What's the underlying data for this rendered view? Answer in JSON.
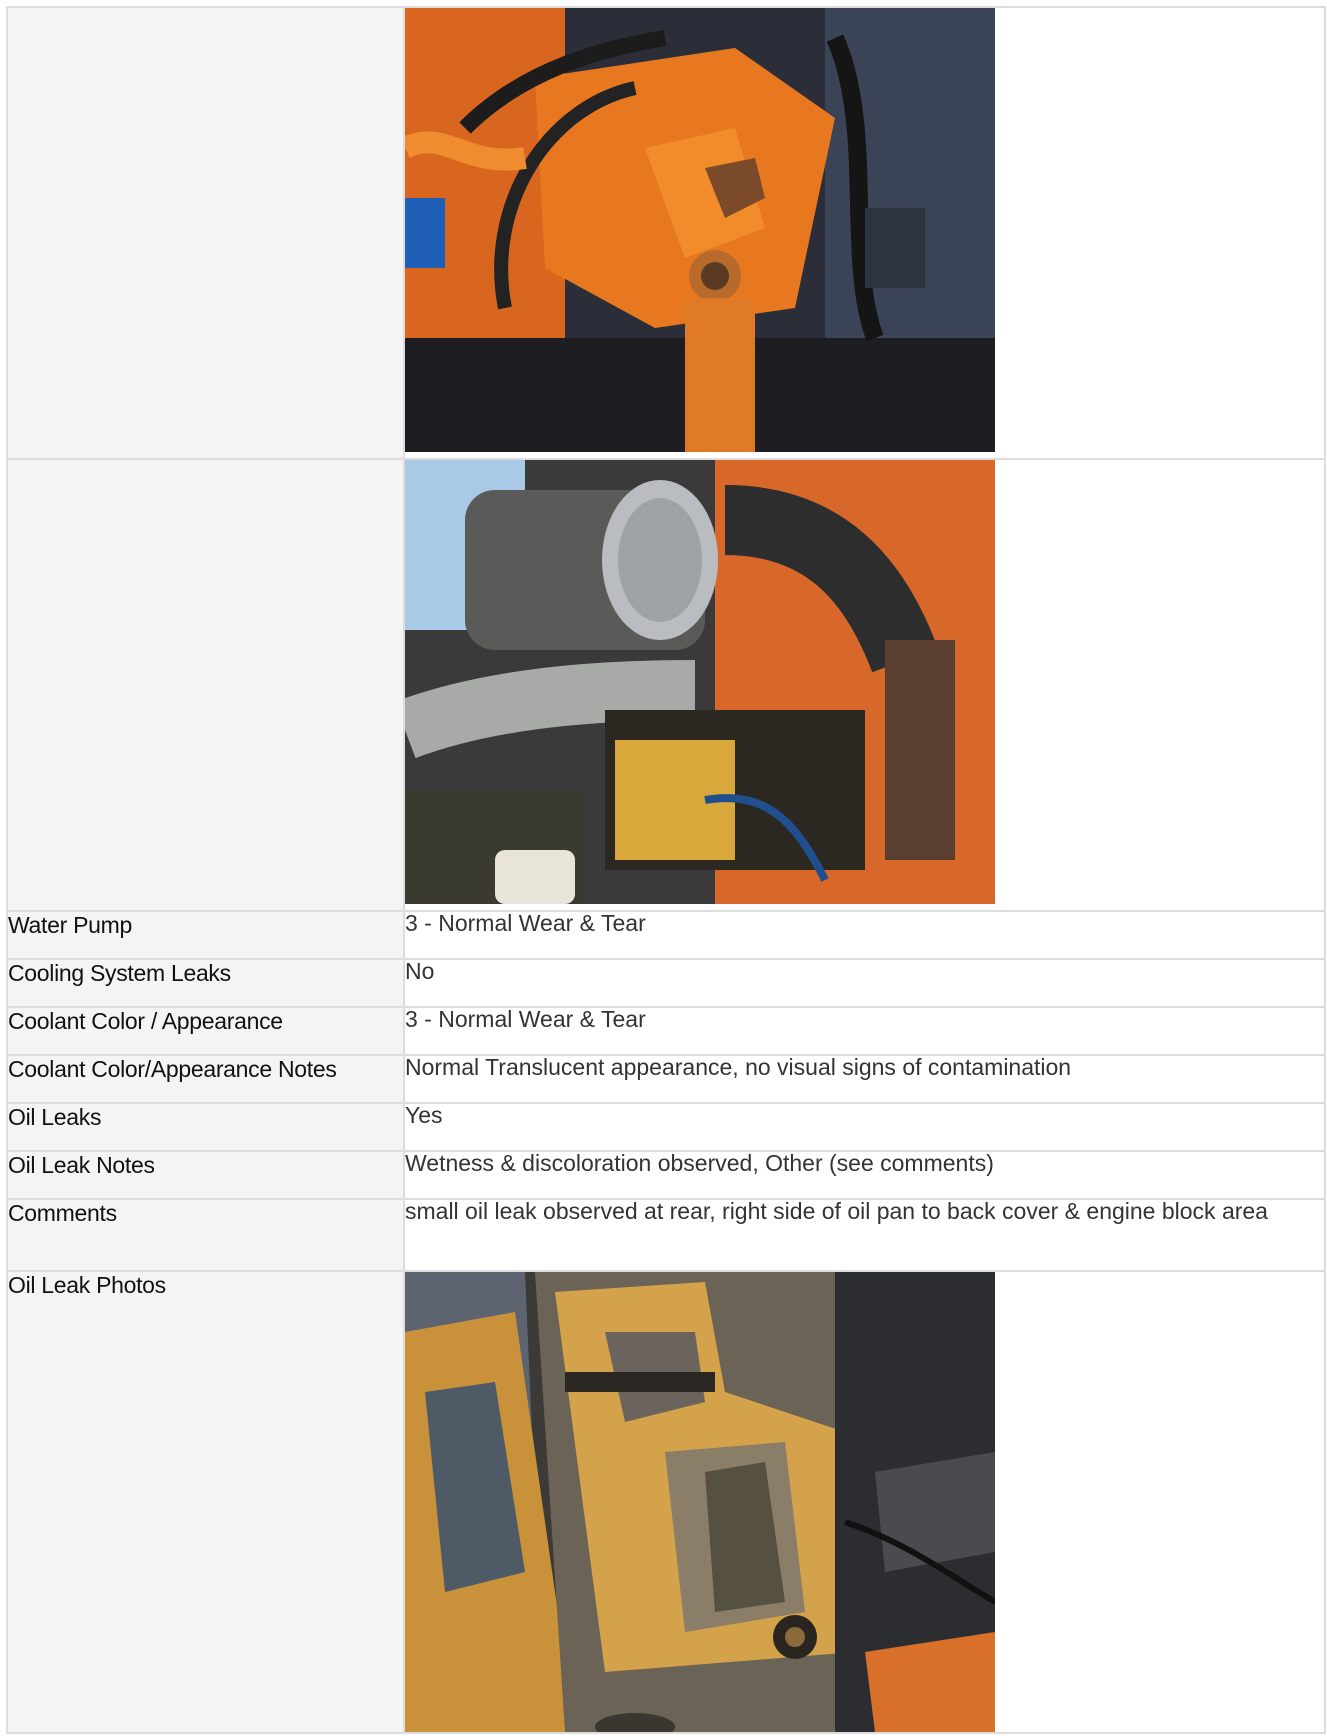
{
  "rows": [
    {
      "label": "Water Pump",
      "value": "3 - Normal Wear & Tear"
    },
    {
      "label": "Cooling System Leaks",
      "value": "No"
    },
    {
      "label": "Coolant Color / Appearance",
      "value": "3 - Normal Wear & Tear"
    },
    {
      "label": "Coolant Color/Appearance Notes",
      "value": "Normal Translucent appearance, no visual signs of contamination"
    },
    {
      "label": "Oil Leaks",
      "value": "Yes"
    },
    {
      "label": "Oil Leak Notes",
      "value": "Wetness & discoloration observed, Other (see comments)"
    },
    {
      "label": "Comments",
      "value": "small oil leak observed at rear, right side of oil pan to back cover & engine block area"
    },
    {
      "label": "Oil Leak Photos",
      "value": ""
    }
  ],
  "photos": {
    "photo1": "orange-steering-gear-photo",
    "photo2": "engine-bay-air-intake-photo",
    "photo3": "oil-pan-leak-photo"
  },
  "colors": {
    "border": "#dddddd",
    "label_bg": "#f4f4f4",
    "orange": "#e8731f"
  }
}
